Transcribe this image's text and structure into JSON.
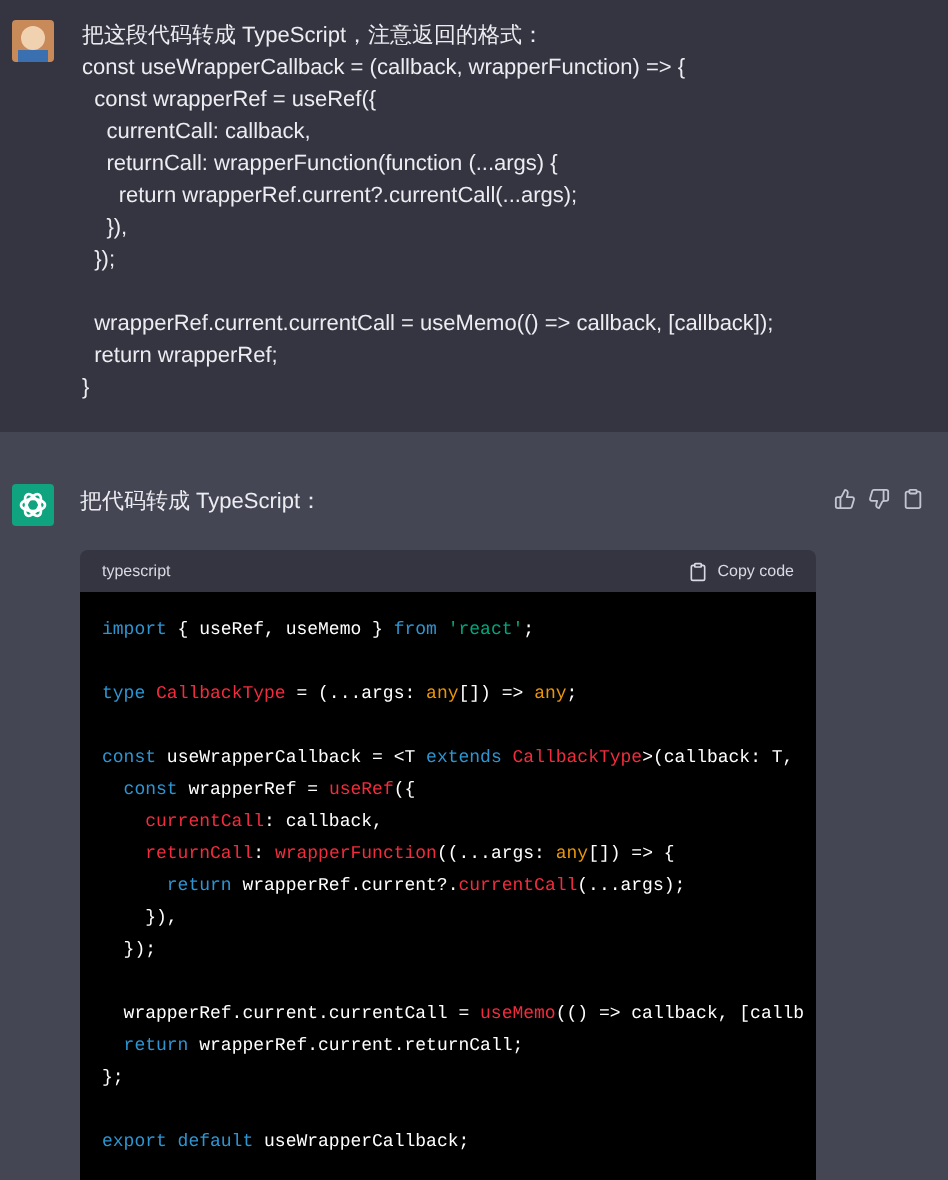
{
  "user_message": {
    "paragraphs": [
      [
        "把这段代码转成 TypeScript，注意返回的格式：",
        "const useWrapperCallback = (callback, wrapperFunction) => {",
        "  const wrapperRef = useRef({",
        "    currentCall: callback,",
        "    returnCall: wrapperFunction(function (...args) {",
        "      return wrapperRef.current?.currentCall(...args);",
        "    }),",
        "  });"
      ],
      [
        "  wrapperRef.current.currentCall = useMemo(() => callback, [callback]);",
        "  return wrapperRef;",
        "}"
      ]
    ]
  },
  "assistant_message": {
    "intro": "把代码转成 TypeScript：",
    "code_block": {
      "language": "typescript",
      "copy_label": "Copy code",
      "blocks": [
        [
          [
            {
              "kind": "kw",
              "text": "import"
            },
            {
              "kind": "plain",
              "text": " { useRef, useMemo } "
            },
            {
              "kind": "kw",
              "text": "from "
            },
            {
              "kind": "str",
              "text": "'react'"
            },
            {
              "kind": "plain",
              "text": ";"
            }
          ]
        ],
        [
          [
            {
              "kind": "kw",
              "text": "type "
            },
            {
              "kind": "fn",
              "text": "CallbackType"
            },
            {
              "kind": "plain",
              "text": " = (...args: "
            },
            {
              "kind": "type",
              "text": "any"
            },
            {
              "kind": "plain",
              "text": "[]) => "
            },
            {
              "kind": "type",
              "text": "any"
            },
            {
              "kind": "plain",
              "text": ";"
            }
          ]
        ],
        [
          [
            {
              "kind": "kw",
              "text": "const"
            },
            {
              "kind": "plain",
              "text": " useWrapperCallback = <T "
            },
            {
              "kind": "kw",
              "text": "extends "
            },
            {
              "kind": "fn",
              "text": "CallbackType"
            },
            {
              "kind": "plain",
              "text": ">(callback: T,"
            }
          ],
          [
            {
              "kind": "kw",
              "text": "  const"
            },
            {
              "kind": "plain",
              "text": " wrapperRef = "
            },
            {
              "kind": "fn",
              "text": "useRef"
            },
            {
              "kind": "plain",
              "text": "({"
            }
          ],
          [
            {
              "kind": "fn",
              "text": "    currentCall"
            },
            {
              "kind": "plain",
              "text": ": callback,"
            }
          ],
          [
            {
              "kind": "fn",
              "text": "    returnCall"
            },
            {
              "kind": "plain",
              "text": ": "
            },
            {
              "kind": "fn",
              "text": "wrapperFunction"
            },
            {
              "kind": "plain",
              "text": "((...args: "
            },
            {
              "kind": "type",
              "text": "any"
            },
            {
              "kind": "plain",
              "text": "[]) => {"
            }
          ],
          [
            {
              "kind": "kw",
              "text": "      return"
            },
            {
              "kind": "plain",
              "text": " wrapperRef.current?."
            },
            {
              "kind": "fn",
              "text": "currentCall"
            },
            {
              "kind": "plain",
              "text": "(...args);"
            }
          ],
          [
            {
              "kind": "plain",
              "text": "    }),"
            }
          ],
          [
            {
              "kind": "plain",
              "text": "  });"
            }
          ]
        ],
        [
          [
            {
              "kind": "plain",
              "text": "  wrapperRef.current.currentCall = "
            },
            {
              "kind": "fn",
              "text": "useMemo"
            },
            {
              "kind": "plain",
              "text": "(() => callback, [callb"
            }
          ],
          [
            {
              "kind": "kw",
              "text": "  return"
            },
            {
              "kind": "plain",
              "text": " wrapperRef.current.returnCall;"
            }
          ],
          [
            {
              "kind": "plain",
              "text": "};"
            }
          ]
        ],
        [
          [
            {
              "kind": "kw",
              "text": "export default"
            },
            {
              "kind": "plain",
              "text": " useWrapperCallback;"
            }
          ]
        ]
      ]
    }
  }
}
